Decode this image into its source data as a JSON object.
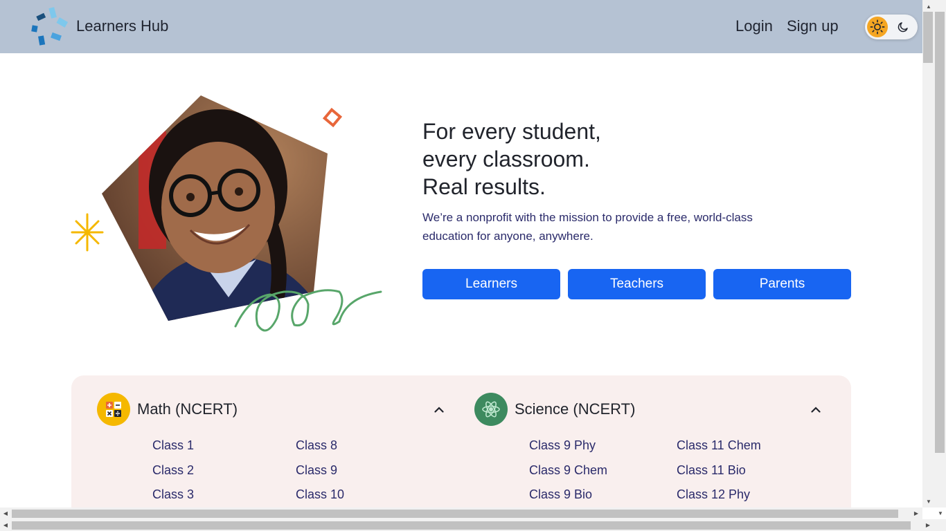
{
  "header": {
    "brand": "Learners Hub",
    "login_label": "Login",
    "signup_label": "Sign up",
    "theme_toggle": {
      "light_icon": "sun-icon",
      "dark_icon": "moon-icon",
      "selected": "light"
    },
    "colors": {
      "background": "#b5c2d3",
      "toggle_active": "#f5a623"
    }
  },
  "hero": {
    "title_lines": [
      "For every student,",
      "every classroom.",
      "Real results."
    ],
    "subtitle": "We’re a nonprofit with the mission to provide a free, world-class education for anyone, anywhere.",
    "buttons": [
      "Learners",
      "Teachers",
      "Parents"
    ],
    "button_color": "#1865f2"
  },
  "subjects": [
    {
      "title": "Math (NCERT)",
      "icon": "calculator-icon",
      "icon_color": "#f5b800",
      "expanded": true,
      "classes_col1": [
        "Class 1",
        "Class 2",
        "Class 3"
      ],
      "classes_col2": [
        "Class 8",
        "Class 9",
        "Class 10"
      ]
    },
    {
      "title": "Science (NCERT)",
      "icon": "atom-icon",
      "icon_color": "#3d8a5f",
      "expanded": true,
      "classes_col1": [
        "Class 9 Phy",
        "Class 9 Chem",
        "Class 9 Bio"
      ],
      "classes_col2": [
        "Class 11 Chem",
        "Class 11 Bio",
        "Class 12 Phy"
      ]
    }
  ],
  "panel_color": "#f9efee"
}
